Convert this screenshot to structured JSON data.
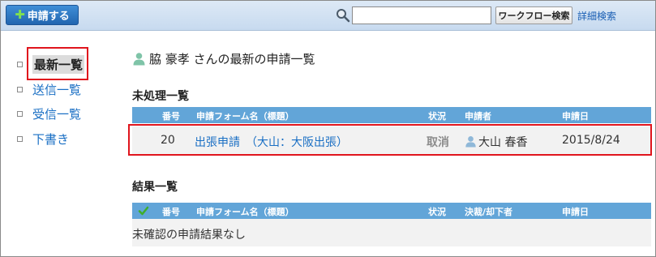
{
  "toolbar": {
    "apply_button_label": "申請する",
    "search_placeholder": "",
    "workflow_search_label": "ワークフロー検索",
    "advanced_search_label": "詳細検索"
  },
  "sidebar": {
    "items": [
      {
        "label": "最新一覧",
        "active": true
      },
      {
        "label": "送信一覧",
        "active": false
      },
      {
        "label": "受信一覧",
        "active": false
      },
      {
        "label": "下書き",
        "active": false
      }
    ]
  },
  "main": {
    "title": "脇 豪孝 さんの最新の申請一覧",
    "pending": {
      "title": "未処理一覧",
      "columns": [
        "番号",
        "申請フォーム名（標題）",
        "状況",
        "申請者",
        "申請日"
      ],
      "rows": [
        {
          "number": "20",
          "form_name": "出張申請　（大山：大阪出張）",
          "status": "取消",
          "applicant": "大山 春香",
          "date": "2015/8/24"
        }
      ]
    },
    "results": {
      "title": "結果一覧",
      "columns": [
        "番号",
        "申請フォーム名（標題）",
        "状況",
        "決裁/却下者",
        "申請日"
      ],
      "empty_message": "未確認の申請結果なし"
    }
  },
  "colors": {
    "header_blue": "#62a5d8",
    "link_blue": "#1a6fc4",
    "highlight_red": "#e0151d"
  }
}
